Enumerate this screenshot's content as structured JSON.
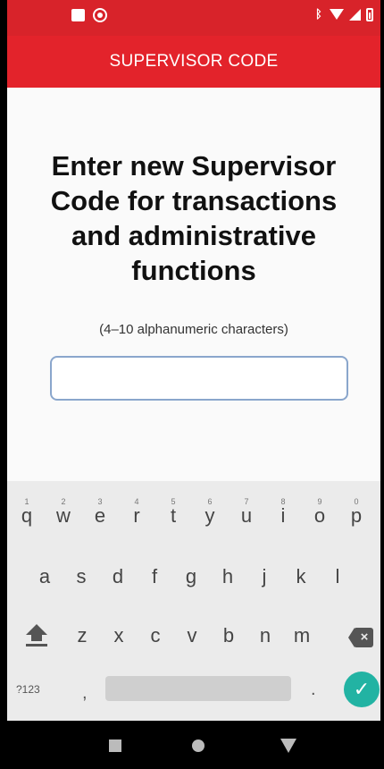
{
  "app_bar": {
    "title": "SUPERVISOR CODE"
  },
  "main": {
    "heading": "Enter new Supervisor Code for transactions and administrative functions",
    "hint": "(4–10 alphanumeric characters)",
    "code_value": "",
    "code_placeholder": ""
  },
  "keyboard": {
    "row1": [
      {
        "key": "q",
        "num": "1"
      },
      {
        "key": "w",
        "num": "2"
      },
      {
        "key": "e",
        "num": "3"
      },
      {
        "key": "r",
        "num": "4"
      },
      {
        "key": "t",
        "num": "5"
      },
      {
        "key": "y",
        "num": "6"
      },
      {
        "key": "u",
        "num": "7"
      },
      {
        "key": "i",
        "num": "8"
      },
      {
        "key": "o",
        "num": "9"
      },
      {
        "key": "p",
        "num": "0"
      }
    ],
    "row2": [
      "a",
      "s",
      "d",
      "f",
      "g",
      "h",
      "j",
      "k",
      "l"
    ],
    "row3": [
      "z",
      "x",
      "c",
      "v",
      "b",
      "n",
      "m"
    ],
    "symbols_label": "?123",
    "comma": ",",
    "period": ".",
    "done_glyph": "✓"
  },
  "colors": {
    "status_bar": "#d8232a",
    "app_bar": "#e3232b",
    "accent_teal": "#22b3a3",
    "input_border": "#8aa6cc"
  },
  "icons": {
    "status_left": [
      "notification-square-icon",
      "sync-icon"
    ],
    "status_right": [
      "bluetooth-icon",
      "wifi-icon",
      "signal-icon",
      "battery-icon"
    ],
    "nav": [
      "back-square-icon",
      "home-circle-icon",
      "recents-triangle-icon"
    ]
  }
}
